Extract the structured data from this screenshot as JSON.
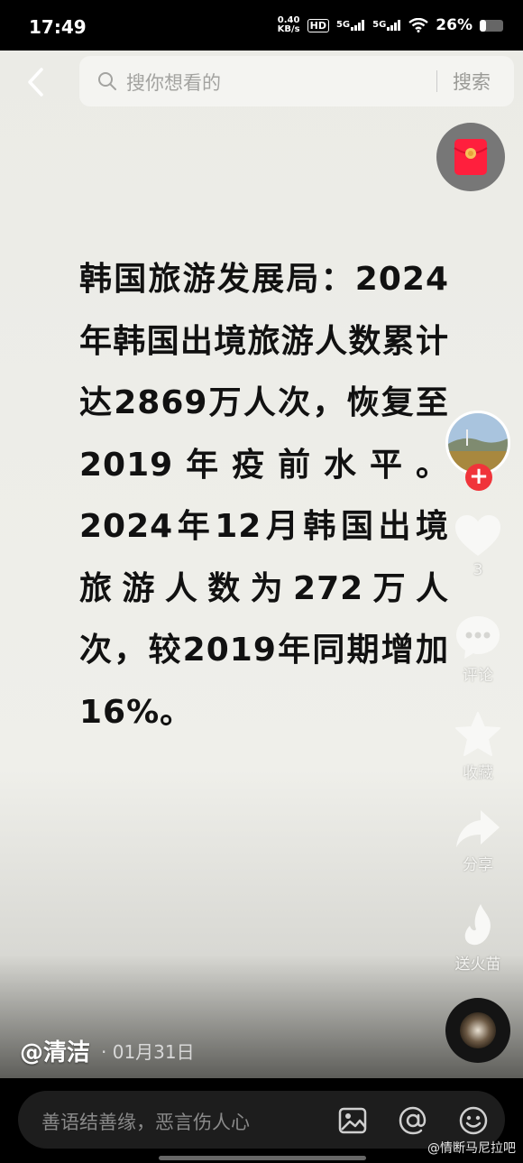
{
  "status_bar": {
    "time": "17:49",
    "net_speed_value": "0.40",
    "net_speed_unit": "KB/s",
    "hd_label": "HD",
    "sim1_label": "5G",
    "sim2_label": "5G",
    "battery_percent_text": "26%",
    "battery_level": 0.26
  },
  "search": {
    "placeholder": "搜你想看的",
    "button_label": "搜索"
  },
  "post": {
    "text": "韩国旅游发展局：2024年韩国出境旅游人数累计达2869万人次，恢复至2019年疫前水平。2024年12月韩国出境旅游人数为272万人次，较2019年同期增加16%。",
    "author": "@清洁",
    "date": "· 01月31日"
  },
  "actions": {
    "like_count": "3",
    "comment_label": "评论",
    "favorite_label": "收藏",
    "share_label": "分享",
    "gift_label": "送火苗"
  },
  "comment_bar": {
    "placeholder": "善语结善缘，恶言伤人心"
  },
  "watermark": "@情断马尼拉吧",
  "colors": {
    "background": "#ebebe6",
    "text": "#111111",
    "accent_red": "#f0343a"
  }
}
